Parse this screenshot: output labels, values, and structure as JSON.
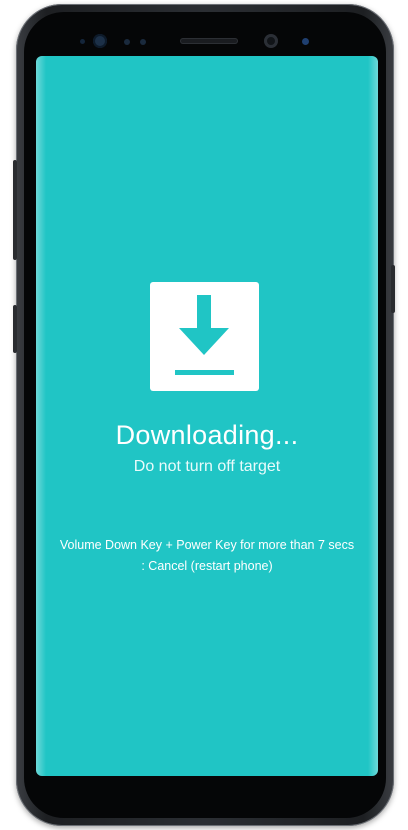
{
  "screen": {
    "background_color": "#20c5c5",
    "icon": "download-icon",
    "title": "Downloading...",
    "subtitle": "Do not turn off target",
    "instruction_line1": "Volume Down Key + Power Key for more than 7 secs",
    "instruction_line2": ": Cancel (restart phone)"
  }
}
